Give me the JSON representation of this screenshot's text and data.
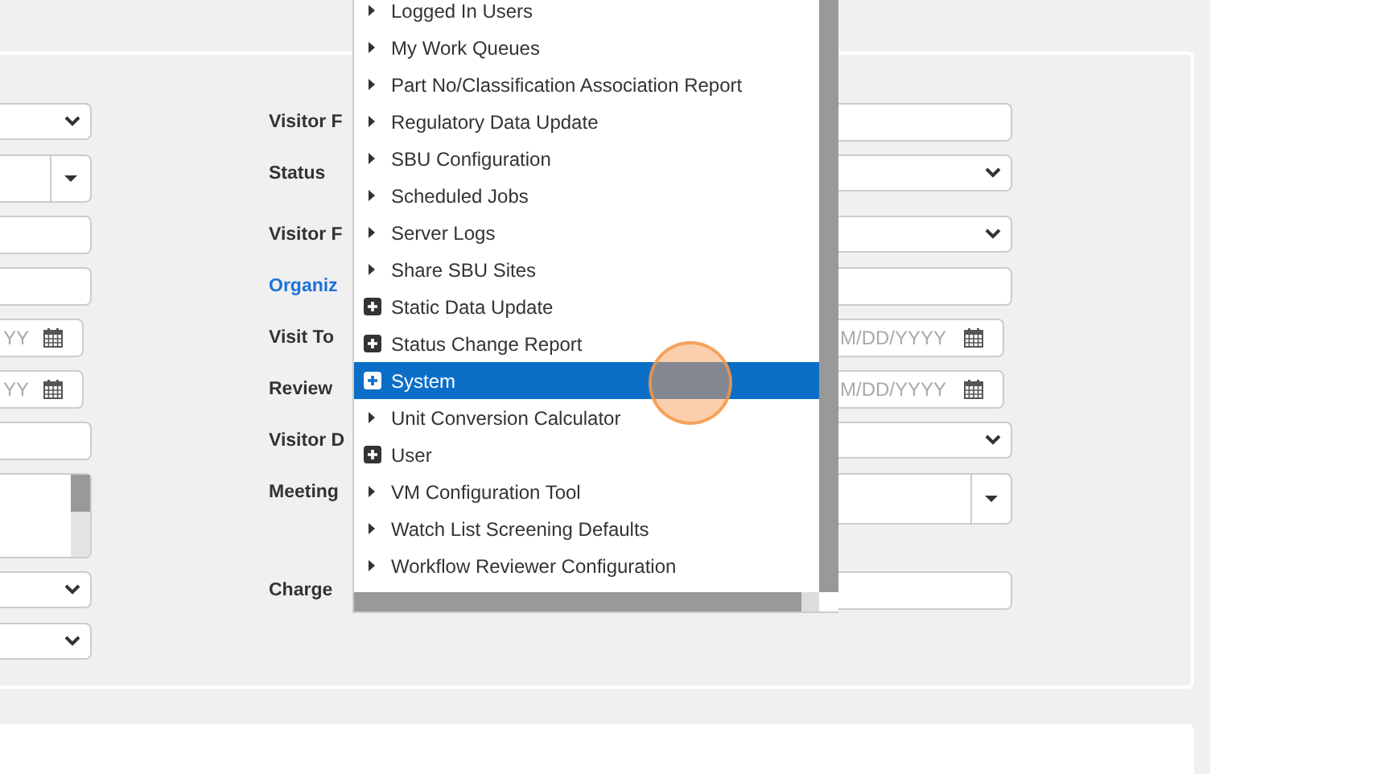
{
  "form": {
    "left_fields": [
      {
        "kind": "select"
      },
      {
        "kind": "combo"
      },
      {
        "kind": "text"
      },
      {
        "kind": "text"
      },
      {
        "kind": "date",
        "placeholder": "YY"
      },
      {
        "kind": "date",
        "placeholder": "YY"
      },
      {
        "kind": "text"
      },
      {
        "kind": "listbox"
      },
      {
        "kind": "select"
      },
      {
        "kind": "select"
      }
    ],
    "rows": [
      {
        "label": "Visitor F",
        "link": false,
        "field": {
          "kind": "text"
        }
      },
      {
        "label": "Status",
        "link": false,
        "field": {
          "kind": "select"
        }
      },
      {
        "label": "Visitor F",
        "link": false,
        "field": {
          "kind": "select"
        }
      },
      {
        "label": "Organiz",
        "link": true,
        "field": {
          "kind": "text"
        }
      },
      {
        "label": "Visit To",
        "link": false,
        "field": {
          "kind": "date",
          "placeholder": "M/DD/YYYY"
        }
      },
      {
        "label": "Review",
        "link": false,
        "field": {
          "kind": "date",
          "placeholder": "M/DD/YYYY"
        }
      },
      {
        "label": "Visitor D",
        "link": false,
        "field": {
          "kind": "select"
        }
      },
      {
        "label": "Meeting",
        "link": false,
        "field": {
          "kind": "combo"
        }
      },
      {
        "label": "Charge",
        "link": false,
        "field": {
          "kind": "text"
        }
      }
    ]
  },
  "menu": {
    "items": [
      {
        "label": "Logged In Users",
        "kind": "leaf",
        "selected": false
      },
      {
        "label": "My Work Queues",
        "kind": "leaf",
        "selected": false
      },
      {
        "label": "Part No/Classification Association Report",
        "kind": "leaf",
        "selected": false
      },
      {
        "label": "Regulatory Data Update",
        "kind": "leaf",
        "selected": false
      },
      {
        "label": "SBU Configuration",
        "kind": "leaf",
        "selected": false
      },
      {
        "label": "Scheduled Jobs",
        "kind": "leaf",
        "selected": false
      },
      {
        "label": "Server Logs",
        "kind": "leaf",
        "selected": false
      },
      {
        "label": "Share SBU Sites",
        "kind": "leaf",
        "selected": false
      },
      {
        "label": "Static Data Update",
        "kind": "group",
        "selected": false
      },
      {
        "label": "Status Change Report",
        "kind": "group",
        "selected": false
      },
      {
        "label": "System",
        "kind": "group",
        "selected": true
      },
      {
        "label": "Unit Conversion Calculator",
        "kind": "leaf",
        "selected": false
      },
      {
        "label": "User",
        "kind": "group",
        "selected": false
      },
      {
        "label": "VM Configuration Tool",
        "kind": "leaf",
        "selected": false
      },
      {
        "label": "Watch List Screening Defaults",
        "kind": "leaf",
        "selected": false
      },
      {
        "label": "Workflow Reviewer Configuration",
        "kind": "leaf",
        "selected": false
      }
    ]
  }
}
